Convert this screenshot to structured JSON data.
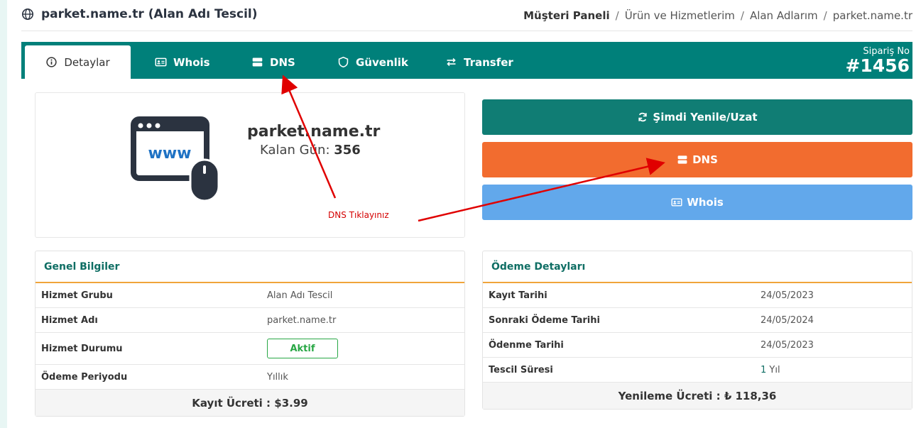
{
  "header": {
    "title": "parket.name.tr (Alan Adı Tescil)",
    "breadcrumb": [
      "Müşteri Paneli",
      "Ürün ve Hizmetlerim",
      "Alan Adlarım",
      "parket.name.tr"
    ],
    "separator": "/"
  },
  "tabs": [
    {
      "label": "Detaylar",
      "icon": "info-circle-icon",
      "active": true
    },
    {
      "label": "Whois",
      "icon": "id-card-icon",
      "active": false
    },
    {
      "label": "DNS",
      "icon": "server-icon",
      "active": false
    },
    {
      "label": "Güvenlik",
      "icon": "shield-icon",
      "active": false
    },
    {
      "label": "Transfer",
      "icon": "exchange-icon",
      "active": false
    }
  ],
  "order": {
    "label": "Sipariş No",
    "number": "#1456"
  },
  "domain_card": {
    "icon": "www-browser-icon",
    "domain": "parket.name.tr",
    "remaining_label": "Kalan Gün:",
    "remaining_days": "356"
  },
  "annotation": {
    "text": "DNS Tıklayınız",
    "color": "#d40000"
  },
  "actions": {
    "renew": "Şimdi Yenile/Uzat",
    "dns": "DNS",
    "whois": "Whois"
  },
  "general": {
    "title": "Genel Bilgiler",
    "rows": [
      {
        "label": "Hizmet Grubu",
        "value": "Alan Adı Tescil"
      },
      {
        "label": "Hizmet Adı",
        "value": "parket.name.tr"
      },
      {
        "label": "Hizmet Durumu",
        "value": "Aktif"
      },
      {
        "label": "Ödeme Periyodu",
        "value": "Yıllık"
      }
    ],
    "footer": "Kayıt Ücreti : $3.99"
  },
  "payment": {
    "title": "Ödeme Detayları",
    "rows": [
      {
        "label": "Kayıt Tarihi",
        "value": "24/05/2023"
      },
      {
        "label": "Sonraki Ödeme Tarihi",
        "value": "24/05/2024"
      },
      {
        "label": "Ödenme Tarihi",
        "value": "24/05/2023"
      },
      {
        "label": "Tescil Süresi",
        "value_num": "1",
        "value_unit": "Yıl"
      }
    ],
    "footer": "Yenileme Ücreti : ₺ 118,36"
  },
  "colors": {
    "teal": "#00807a",
    "orange": "#f26c2f",
    "blue": "#62a8eb",
    "accent_line": "#f0a43a",
    "status_green": "#28a745"
  }
}
